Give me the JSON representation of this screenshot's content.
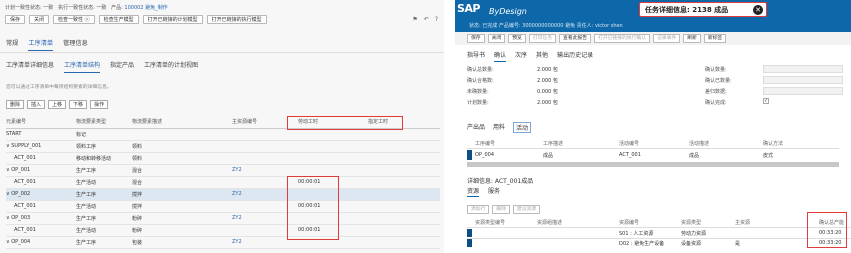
{
  "left": {
    "topinfo": {
      "plan_status": "计划一致性状态: 一致",
      "exec_status": "执行一致性状态: 一致",
      "product_label": "产品:",
      "product_value": "100002 避免_制作"
    },
    "toolbar": [
      "保存",
      "关闭",
      "检查一致性 ⓥ",
      "检查生产模型",
      "打开已链接的计划模型",
      "打开已链接的执行模型"
    ],
    "toolbar_icons": [
      "flag-icon",
      "undo-icon",
      "help-icon"
    ],
    "tabs": [
      "常规",
      "工序清单",
      "管理信息"
    ],
    "active_tab": 1,
    "subtabs": [
      "工序清单详细信息",
      "工序清单结构",
      "指定产品",
      "工序清单的计划视图"
    ],
    "active_subtab": 1,
    "hint": "您可以通过工序清单中每项结构要素的详细信息。",
    "actions": [
      "删除",
      "插入",
      "上移",
      "下移",
      "操作"
    ],
    "columns": [
      "元素编号",
      "物流要素类型",
      "物流要素描述",
      "主资源编号",
      "劳动工时",
      "指定工时"
    ],
    "rows": [
      {
        "id": "START",
        "type": "标记",
        "desc": "",
        "res": "",
        "labor": "",
        "assigned": "",
        "indent": 0,
        "sel": false
      },
      {
        "id": "∨ SUPPLY_001",
        "type": "领料工序",
        "desc": "领料",
        "res": "",
        "labor": "",
        "assigned": "",
        "indent": 0,
        "sel": false
      },
      {
        "id": "ACT_001",
        "type": "移动和转移活动",
        "desc": "领料",
        "res": "",
        "labor": "",
        "assigned": "",
        "indent": 1,
        "sel": false
      },
      {
        "id": "∨ OP_001",
        "type": "生产工序",
        "desc": "混合",
        "res": "ZY2",
        "labor": "",
        "assigned": "",
        "indent": 0,
        "sel": false
      },
      {
        "id": "ACT_001",
        "type": "生产活动",
        "desc": "混合",
        "res": "",
        "labor": "00:00:01",
        "assigned": "",
        "indent": 1,
        "sel": false
      },
      {
        "id": "∨ OP_002",
        "type": "生产工序",
        "desc": "搅拌",
        "res": "ZY2",
        "labor": "",
        "assigned": "",
        "indent": 0,
        "sel": true
      },
      {
        "id": "ACT_001",
        "type": "生产活动",
        "desc": "搅拌",
        "res": "",
        "labor": "00:00:01",
        "assigned": "",
        "indent": 1,
        "sel": false
      },
      {
        "id": "∨ OP_003",
        "type": "生产工序",
        "desc": "粉碎",
        "res": "ZY2",
        "labor": "",
        "assigned": "",
        "indent": 0,
        "sel": false
      },
      {
        "id": "ACT_001",
        "type": "生产活动",
        "desc": "粉碎",
        "res": "",
        "labor": "00:00:01",
        "assigned": "",
        "indent": 1,
        "sel": false
      },
      {
        "id": "∨ OP_004",
        "type": "生产工序",
        "desc": "包装",
        "res": "ZY2",
        "labor": "",
        "assigned": "",
        "indent": 0,
        "sel": false
      }
    ]
  },
  "right": {
    "logo": "SAP",
    "logo_sub": "ByDesign",
    "task_title": "任务详细信息: 2138 成品",
    "close_icon": "close-icon",
    "header_info": "状态: 已完成    产品编号: 3000000000000    避免    责任人: victor shen",
    "toolbar": [
      {
        "label": "保存",
        "dis": false
      },
      {
        "label": "关闭",
        "dis": false
      },
      {
        "label": "预览",
        "dis": false
      },
      {
        "label": "打印任务",
        "dis": true
      },
      {
        "label": "查看此报告",
        "dis": false
      },
      {
        "label": "打开已链接的执行确认",
        "dis": true
      },
      {
        "label": "记录事件",
        "dis": true
      },
      {
        "label": "刷新",
        "dis": false
      },
      {
        "label": "新标签",
        "dis": false
      }
    ],
    "tabs": [
      "指导书",
      "确认",
      "次序",
      "其他",
      "输出历史记录"
    ],
    "active_tab": 1,
    "form_left": [
      {
        "label": "确认总数量:",
        "value": "2.000 包"
      },
      {
        "label": "确认合格数:",
        "value": "2.000 包"
      },
      {
        "label": "未确数量:",
        "value": "0.000 包"
      },
      {
        "label": "计划数量:",
        "value": "2.000 包"
      }
    ],
    "form_right": [
      {
        "label": "确认数量:"
      },
      {
        "label": "确认已数量:"
      },
      {
        "label": "差归数据:"
      },
      {
        "label": "确认完成:"
      }
    ],
    "subtabs1": [
      "产出品",
      "用料",
      "活动"
    ],
    "grid1_cols": [
      "工序编号",
      "工序描述",
      "活动编号",
      "活动描述",
      "确认方法"
    ],
    "grid1_row": [
      "OP_004",
      "成品",
      "ACT_001",
      "成品",
      "皮式"
    ],
    "info_title": "详细信息: ACT_001成品",
    "subtabs2": [
      "资源",
      "服务"
    ],
    "grid2_actions": [
      "添加行",
      "删除",
      "建议资源"
    ],
    "grid2_cols": [
      "资源类型编号",
      "资源组描述",
      "资源编号",
      "资源类型",
      "主资源",
      "确认总产能"
    ],
    "grid2_rows": [
      {
        "res": "S01 : 人工资源",
        "type": "劳动力资源",
        "main": "",
        "cap": "00:33:20"
      },
      {
        "res": "D02 : 避免生产设备",
        "type": "设备资源",
        "main": "是",
        "cap": "00:33:20"
      }
    ]
  }
}
